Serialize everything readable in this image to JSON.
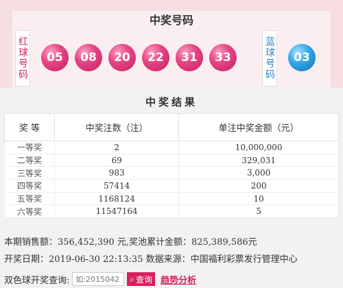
{
  "draw": {
    "title": "中奖号码",
    "red_label": "红球号码",
    "blue_label": "蓝球号码",
    "red_balls": [
      "05",
      "08",
      "20",
      "22",
      "31",
      "33"
    ],
    "blue_ball": "03"
  },
  "results": {
    "title": "中奖结果",
    "headers": [
      "奖 等",
      "中奖注数（注）",
      "单注中奖金额（元）"
    ],
    "rows": [
      [
        "一等奖",
        "2",
        "10,000,000"
      ],
      [
        "二等奖",
        "69",
        "329,031"
      ],
      [
        "三等奖",
        "983",
        "3,000"
      ],
      [
        "四等奖",
        "57414",
        "200"
      ],
      [
        "五等奖",
        "1168124",
        "10"
      ],
      [
        "六等奖",
        "11547164",
        "5"
      ]
    ]
  },
  "info": {
    "sales_line": "本期销售额：356,452,390 元,奖池累计金额：825,389,586元",
    "date_line": "开奖日期：2019-06-30 22:13:35 数据来源：中国福利彩票发行管理中心"
  },
  "query": {
    "label": "双色球开奖查询:",
    "placeholder": "如:2015042",
    "button": "查询",
    "trend": "趋势分析"
  },
  "colors": {
    "red": "#d81e5b",
    "blue": "#2e86c1"
  }
}
